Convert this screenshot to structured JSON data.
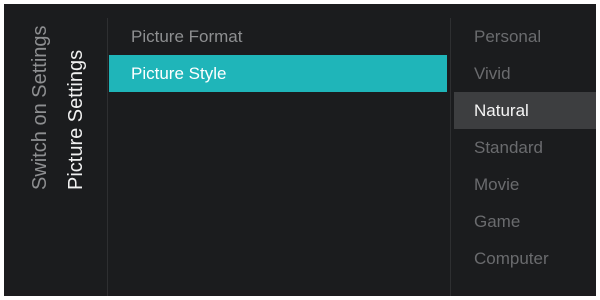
{
  "breadcrumb": {
    "parent": "Switch on Settings",
    "current": "Picture Settings"
  },
  "menu": {
    "items": [
      {
        "label": "Picture Format",
        "selected": false
      },
      {
        "label": "Picture Style",
        "selected": true
      }
    ]
  },
  "options": {
    "items": [
      {
        "label": "Personal",
        "highlighted": false
      },
      {
        "label": "Vivid",
        "highlighted": false
      },
      {
        "label": "Natural",
        "highlighted": true
      },
      {
        "label": "Standard",
        "highlighted": false
      },
      {
        "label": "Movie",
        "highlighted": false
      },
      {
        "label": "Game",
        "highlighted": false
      },
      {
        "label": "Computer",
        "highlighted": false
      }
    ]
  },
  "colors": {
    "background": "#1b1c1e",
    "accent": "#1fb5b9",
    "highlight": "#3d3e40",
    "text_active": "#ffffff",
    "text_inactive": "#8e8f91",
    "text_dim": "#6a6b6e"
  }
}
